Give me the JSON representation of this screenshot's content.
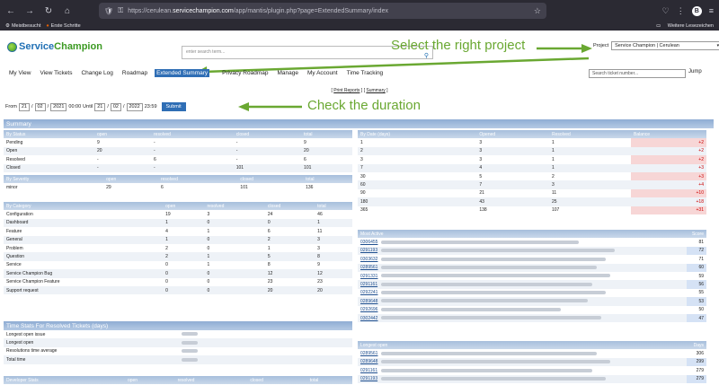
{
  "browser": {
    "url_prefix": "https://cerulean.",
    "url_domain": "servicechampion.com",
    "url_rest": "/app/mantis/plugin.php?page=ExtendedSummary/index",
    "bm1": "Meistbesucht",
    "bm2": "Erste Schritte",
    "bm_right": "Weitere Lesezeichen",
    "nav_back": "←",
    "nav_fwd": "→",
    "nav_reload": "↻",
    "nav_home": "⌂",
    "shield": "🛡",
    "lock": "⚿",
    "star": "☆",
    "ext1": "♡",
    "ext2": "⋮",
    "av": "B",
    "menu_icon": "≡",
    "bm_gear": "⚙",
    "bm_fire": "●",
    "bm_folder": "▭"
  },
  "logo": {
    "part1": "Service",
    "part2": "Champion"
  },
  "search": {
    "placeholder": "enter search term...",
    "icon": "⚲"
  },
  "project": {
    "label": "Project",
    "value": "Service Champion | Cerulean",
    "caret": "▾"
  },
  "annotations": {
    "project": "Select the right project",
    "duration": "Check the duration"
  },
  "menu": [
    "My View",
    "View Tickets",
    "Change Log",
    "Roadmap",
    "Extended Summary",
    "Privacy Roadmap",
    "Manage",
    "My Account",
    "Time Tracking"
  ],
  "ticket_search": {
    "placeholder": "Search ticket number...",
    "jump": "Jump"
  },
  "links": {
    "print": "Print Reports",
    "summary": "Summary",
    "lb": "[ ",
    "sep": " ] [ ",
    "rb": " ]"
  },
  "duration": {
    "from": "From",
    "d1": "21",
    "m1": "02",
    "y1": "2021",
    "t1": "00:00",
    "until": "Until",
    "d2": "21",
    "m2": "02",
    "y2": "2022",
    "t2": "23:59",
    "submit": "Submit",
    "slash": "/"
  },
  "summary_title": "Summary",
  "status": {
    "headers": [
      "By Status",
      "open",
      "resolved",
      "closed",
      "total"
    ],
    "rows": [
      [
        "Pending",
        "9",
        "-",
        "-",
        "9"
      ],
      [
        "Open",
        "20",
        "-",
        "-",
        "20"
      ],
      [
        "Resolved",
        "-",
        "6",
        "-",
        "6"
      ],
      [
        "Closed",
        "-",
        "-",
        "101",
        "101"
      ]
    ]
  },
  "severity": {
    "headers": [
      "By Severity",
      "open",
      "resolved",
      "closed",
      "total"
    ],
    "rows": [
      [
        "minor",
        "29",
        "6",
        "101",
        "136"
      ]
    ]
  },
  "category": {
    "headers": [
      "By Category",
      "open",
      "resolved",
      "closed",
      "total"
    ],
    "rows": [
      [
        "Configuration",
        "19",
        "3",
        "24",
        "46"
      ],
      [
        "Dashboard",
        "1",
        "0",
        "0",
        "1"
      ],
      [
        "Feature",
        "4",
        "1",
        "6",
        "11"
      ],
      [
        "General",
        "1",
        "0",
        "2",
        "3"
      ],
      [
        "Problem",
        "2",
        "0",
        "1",
        "3"
      ],
      [
        "Question",
        "2",
        "1",
        "5",
        "8"
      ],
      [
        "Service",
        "0",
        "1",
        "8",
        "9"
      ],
      [
        "Service Champion Bug",
        "0",
        "0",
        "12",
        "12"
      ],
      [
        "Service Champion Feature",
        "0",
        "0",
        "23",
        "23"
      ],
      [
        "Support request",
        "0",
        "0",
        "20",
        "20"
      ]
    ]
  },
  "timestats": {
    "title": "Time Stats For Resolved Tickets (days)",
    "rows": [
      "Longest open issue",
      "Longest open",
      "Resolutions time average",
      "Total time"
    ]
  },
  "developer": {
    "headers": [
      "Developer Stats",
      "open",
      "resolved",
      "closed",
      "total"
    ]
  },
  "bydate": {
    "headers": [
      "By Date (days)",
      "Opened",
      "Resolved",
      "Balance"
    ],
    "rows": [
      [
        "1",
        "3",
        "1",
        "+2"
      ],
      [
        "2",
        "3",
        "1",
        "+2"
      ],
      [
        "3",
        "3",
        "1",
        "+2"
      ],
      [
        "7",
        "4",
        "1",
        "+3"
      ],
      [
        "30",
        "5",
        "2",
        "+3"
      ],
      [
        "60",
        "7",
        "3",
        "+4"
      ],
      [
        "90",
        "21",
        "11",
        "+10"
      ],
      [
        "180",
        "43",
        "25",
        "+18"
      ],
      [
        "365",
        "138",
        "107",
        "+31"
      ]
    ]
  },
  "mostactive": {
    "headers": [
      "Most Active",
      "Score"
    ],
    "rows": [
      [
        "0306455",
        "81"
      ],
      [
        "0291193",
        "72"
      ],
      [
        "0303632",
        "71"
      ],
      [
        "0289561",
        "60"
      ],
      [
        "0291331",
        "59"
      ],
      [
        "0291161",
        "56"
      ],
      [
        "0292241",
        "55"
      ],
      [
        "0289648",
        "53"
      ],
      [
        "0292696",
        "50"
      ],
      [
        "0302442",
        "47"
      ]
    ]
  },
  "longestopen": {
    "headers": [
      "Longest open",
      "Days"
    ],
    "rows": [
      [
        "0289561",
        "306"
      ],
      [
        "0289648",
        "299"
      ],
      [
        "0291161",
        "279"
      ],
      [
        "0291193",
        "279"
      ]
    ]
  }
}
